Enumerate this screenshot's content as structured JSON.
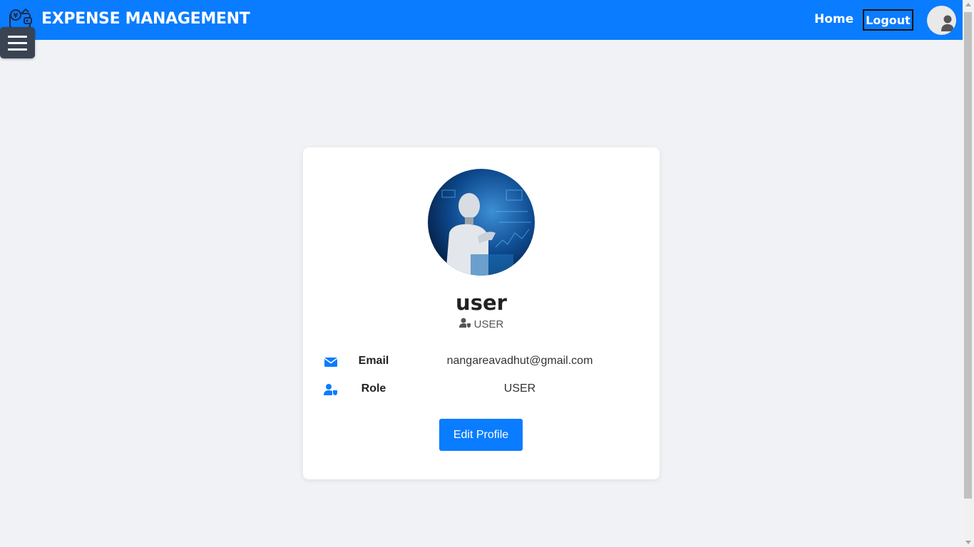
{
  "navbar": {
    "brand_title": "EXPENSE MANAGEMENT",
    "home_label": "Home",
    "logout_label": "Logout",
    "brand_icon": "wallet-money-icon",
    "avatar_icon": "user-avatar-icon",
    "background_color": "#0a7cff"
  },
  "menu": {
    "icon": "hamburger-menu-icon"
  },
  "profile": {
    "username": "user",
    "role_badge": "USER",
    "picture": "robot-profile-picture",
    "fields": [
      {
        "label": "Email",
        "value": "nangareavadhut@gmail.com",
        "icon": "envelope-icon"
      },
      {
        "label": "Role",
        "value": "USER",
        "icon": "user-shield-icon"
      }
    ],
    "edit_label": "Edit Profile"
  },
  "colors": {
    "accent": "#0a7cff",
    "page_background": "#f0f2f5",
    "card_background": "#ffffff"
  }
}
